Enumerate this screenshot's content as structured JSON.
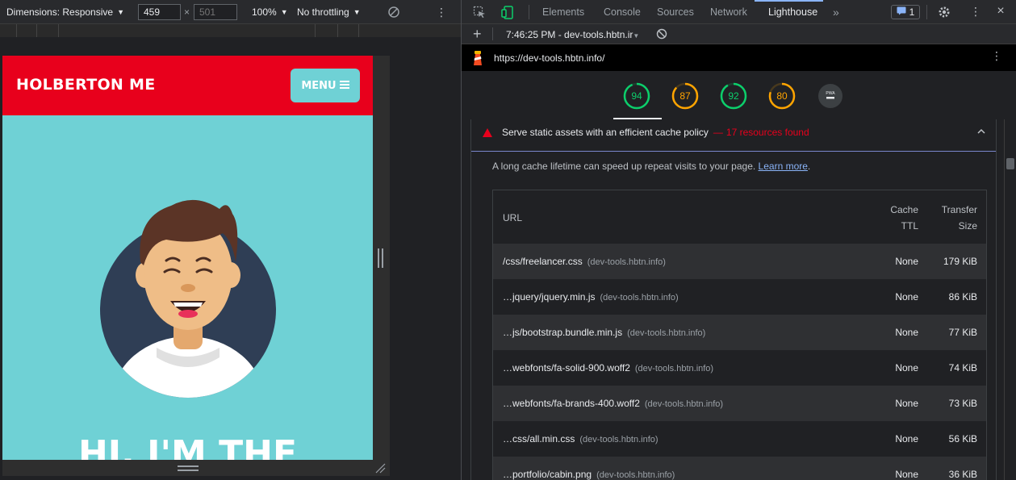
{
  "device_toolbar": {
    "dimensions_label": "Dimensions: Responsive",
    "width_value": "459",
    "height_placeholder": "501",
    "times": "×",
    "zoom": "100%",
    "throttling": "No throttling",
    "more_icon": "vertical-ellipsis-icon",
    "rotate_icon": "rotate-icon"
  },
  "site": {
    "brand": "HOLBERTON ME",
    "menu_label": "MENU",
    "menu_icon": "hamburger-icon",
    "hero_title": "HI, I'M THE",
    "colors": {
      "header": "#e8001c",
      "background": "#6fd1d5",
      "avatar_circle": "#2f3e55"
    }
  },
  "devtools": {
    "tabs": [
      {
        "label": "Elements",
        "active": false
      },
      {
        "label": "Console",
        "active": false
      },
      {
        "label": "Sources",
        "active": false
      },
      {
        "label": "Network",
        "active": false
      },
      {
        "label": "Lighthouse",
        "active": true
      }
    ],
    "more_tabs": "»",
    "issues_count": "1",
    "icons": [
      "inspect-element-icon",
      "device-toolbar-icon",
      "issues-icon",
      "settings-gear-icon",
      "vertical-ellipsis-icon",
      "close-icon"
    ],
    "close": "×"
  },
  "lighthouse": {
    "add": "+",
    "report_label": "7:46:25 PM - dev-tools.hbtn.ir",
    "url": "https://dev-tools.hbtn.info/",
    "gauges": [
      {
        "value": 94,
        "color": "#0cce6b"
      },
      {
        "value": 87,
        "color": "#ffa400"
      },
      {
        "value": 92,
        "color": "#0cce6b"
      },
      {
        "value": 80,
        "color": "#ffa400"
      }
    ],
    "pwa": {
      "label": "PWA"
    },
    "audit": {
      "title": "Serve static assets with an efficient cache policy",
      "dash": "—",
      "found": "17 resources found",
      "description": "A long cache lifetime can speed up repeat visits to your page.",
      "learn_more": "Learn more",
      "period": ".",
      "table": {
        "headers": {
          "url": "URL",
          "ttl_line1": "Cache",
          "ttl_line2": "TTL",
          "size_line1": "Transfer",
          "size_line2": "Size"
        },
        "rows": [
          {
            "url": "/css/freelancer.css",
            "host": "(dev-tools.hbtn.info)",
            "ttl": "None",
            "size": "179 KiB"
          },
          {
            "url": "…jquery/jquery.min.js",
            "host": "(dev-tools.hbtn.info)",
            "ttl": "None",
            "size": "86 KiB"
          },
          {
            "url": "…js/bootstrap.bundle.min.js",
            "host": "(dev-tools.hbtn.info)",
            "ttl": "None",
            "size": "77 KiB"
          },
          {
            "url": "…webfonts/fa-solid-900.woff2",
            "host": "(dev-tools.hbtn.info)",
            "ttl": "None",
            "size": "74 KiB"
          },
          {
            "url": "…webfonts/fa-brands-400.woff2",
            "host": "(dev-tools.hbtn.info)",
            "ttl": "None",
            "size": "73 KiB"
          },
          {
            "url": "…css/all.min.css",
            "host": "(dev-tools.hbtn.info)",
            "ttl": "None",
            "size": "56 KiB"
          },
          {
            "url": "…portfolio/cabin.png",
            "host": "(dev-tools.hbtn.info)",
            "ttl": "None",
            "size": "36 KiB"
          }
        ]
      }
    }
  }
}
